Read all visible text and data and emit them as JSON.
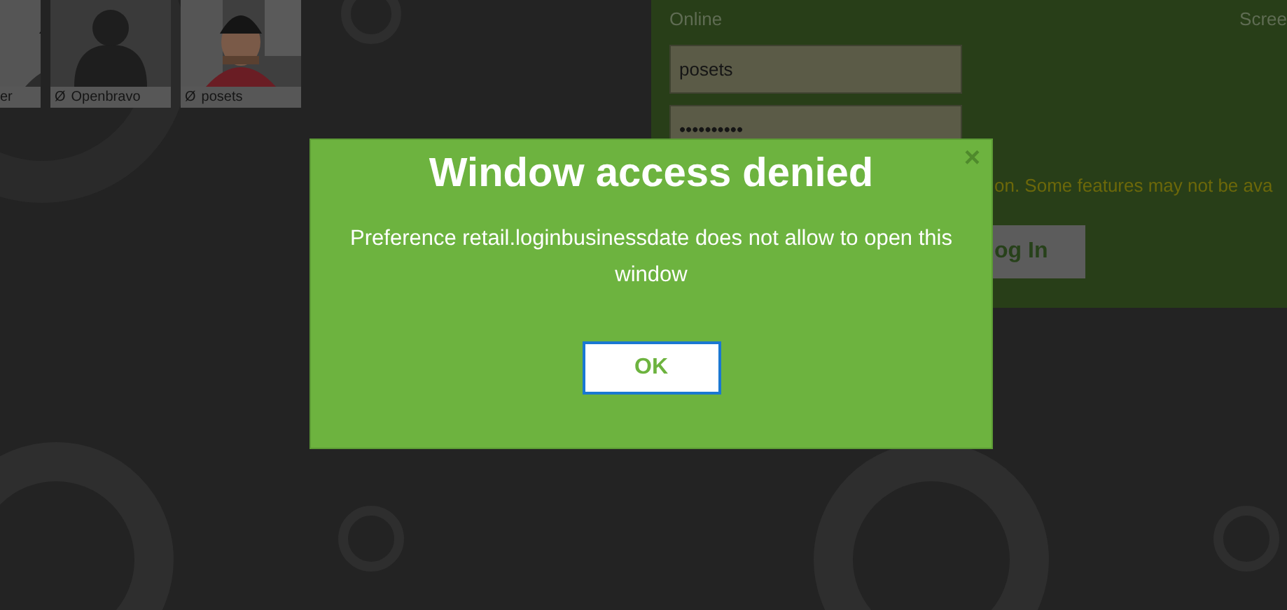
{
  "users": [
    {
      "name": "er"
    },
    {
      "name": "Openbravo",
      "status": "Ø",
      "kind": "default"
    },
    {
      "name": "posets",
      "status": "Ø"
    }
  ],
  "login": {
    "connection": "Online",
    "screen_label": "Scree",
    "username": "posets",
    "password": "••••••••••",
    "warning": "on. Some features may not be ava",
    "login_button": "og In"
  },
  "dialog": {
    "title": "Window access denied",
    "close": "×",
    "message": "Preference retail.loginbusinessdate does not allow to open this window",
    "button": "OK"
  }
}
